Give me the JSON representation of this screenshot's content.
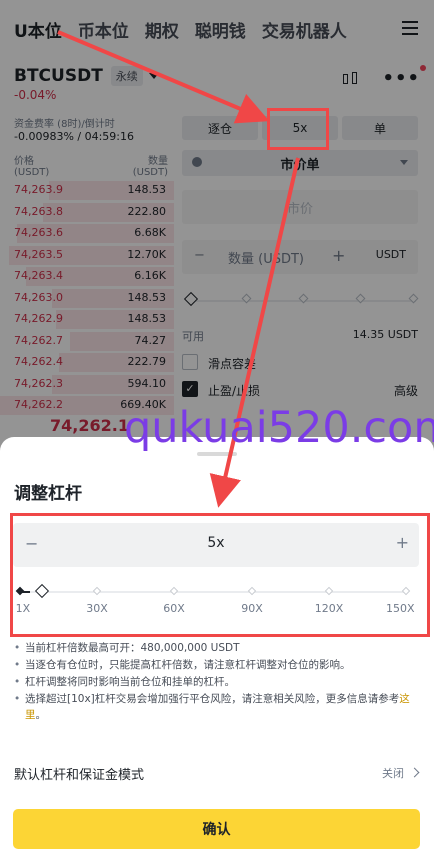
{
  "nav": {
    "tabs": [
      "U本位",
      "币本位",
      "期权",
      "聪明钱",
      "交易机器人"
    ]
  },
  "symbol": {
    "name": "BTCUSDT",
    "badge": "永续",
    "change": "-0.04%"
  },
  "funding": {
    "label": "资金费率 (8时)/倒计时",
    "value": "-0.00983% / 04:59:16"
  },
  "orderbook": {
    "price_header": "价格",
    "price_unit": "(USDT)",
    "qty_header": "数量",
    "qty_unit": "(USDT)",
    "asks": [
      {
        "price": "74,263.9",
        "qty": "148.53",
        "depth": 0.72
      },
      {
        "price": "74,263.8",
        "qty": "222.80",
        "depth": 0.75
      },
      {
        "price": "74,263.6",
        "qty": "6.68K",
        "depth": 0.9
      },
      {
        "price": "74,263.5",
        "qty": "12.70K",
        "depth": 0.95
      },
      {
        "price": "74,263.4",
        "qty": "6.16K",
        "depth": 0.85
      },
      {
        "price": "74,263.0",
        "qty": "148.53",
        "depth": 0.7
      },
      {
        "price": "74,262.9",
        "qty": "148.53",
        "depth": 0.68
      },
      {
        "price": "74,262.7",
        "qty": "74.27",
        "depth": 0.6
      },
      {
        "price": "74,262.4",
        "qty": "222.79",
        "depth": 0.66
      },
      {
        "price": "74,262.3",
        "qty": "594.10",
        "depth": 0.7
      },
      {
        "price": "74,262.2",
        "qty": "669.40K",
        "depth": 1.0
      }
    ],
    "last_price": "74,262.1"
  },
  "order_form": {
    "margin_mode": "逐仓",
    "leverage": "5x",
    "position_mode": "单",
    "order_type": "市价单",
    "price_placeholder": "市价",
    "qty_label": "数量 (USDT)",
    "qty_unit": "USDT",
    "available_label": "可用",
    "available_value": "14.35 USDT",
    "slippage_label": "滑点容差",
    "tpsl_label": "止盈/止损",
    "advanced_label": "高级"
  },
  "sheet": {
    "title": "调整杠杆",
    "leverage_value": "5x",
    "minus": "−",
    "plus": "+",
    "slider_level": 0.027,
    "tick_labels": [
      "1X",
      "30X",
      "60X",
      "90X",
      "120X",
      "150X"
    ],
    "notes": [
      "当前杠杆倍数最高可开：480,000,000 USDT",
      "当逐仓有仓位时，只能提高杠杆倍数，请注意杠杆调整对仓位的影响。",
      "杠杆调整将同时影响当前仓位和挂单的杠杆。"
    ],
    "risk_note": "选择超过[10x]杠杆交易会增加强行平仓风险，请注意相关风险，更多信息请参考",
    "risk_link": "这里",
    "risk_end": "。",
    "default_mode_label": "默认杠杆和保证金模式",
    "default_mode_value": "关闭",
    "confirm_label": "确认"
  },
  "watermark": "qukuai520.com",
  "colors": {
    "sell": "#cf304a",
    "accent": "#fcd535",
    "annotation": "#f04747",
    "watermark": "#7b3ce6"
  }
}
